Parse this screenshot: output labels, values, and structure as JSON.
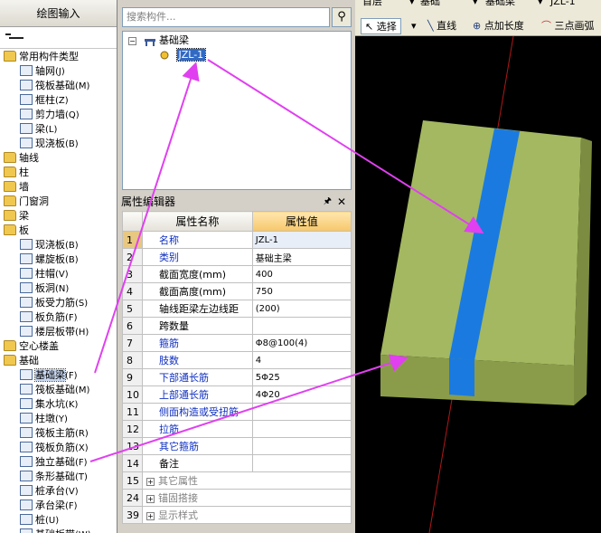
{
  "left_panel": {
    "header": "绘图输入",
    "items": [
      {
        "label": "常用构件类型",
        "type": "folder"
      },
      {
        "label": "轴网",
        "shortcut": "(J)",
        "type": "item"
      },
      {
        "label": "筏板基础",
        "shortcut": "(M)",
        "type": "item"
      },
      {
        "label": "框柱",
        "shortcut": "(Z)",
        "type": "item"
      },
      {
        "label": "剪力墙",
        "shortcut": "(Q)",
        "type": "item"
      },
      {
        "label": "梁",
        "shortcut": "(L)",
        "type": "item"
      },
      {
        "label": "现浇板",
        "shortcut": "(B)",
        "type": "item"
      },
      {
        "label": "轴线",
        "type": "folder"
      },
      {
        "label": "柱",
        "type": "folder"
      },
      {
        "label": "墙",
        "type": "folder"
      },
      {
        "label": "门窗洞",
        "type": "folder"
      },
      {
        "label": "梁",
        "type": "folder"
      },
      {
        "label": "板",
        "type": "folder"
      },
      {
        "label": "现浇板",
        "shortcut": "(B)",
        "type": "item"
      },
      {
        "label": "螺旋板",
        "shortcut": "(B)",
        "type": "item"
      },
      {
        "label": "柱帽",
        "shortcut": "(V)",
        "type": "item"
      },
      {
        "label": "板洞",
        "shortcut": "(N)",
        "type": "item"
      },
      {
        "label": "板受力筋",
        "shortcut": "(S)",
        "type": "item"
      },
      {
        "label": "板负筋",
        "shortcut": "(F)",
        "type": "item"
      },
      {
        "label": "楼层板带",
        "shortcut": "(H)",
        "type": "item"
      },
      {
        "label": "空心楼盖",
        "type": "folder"
      },
      {
        "label": "基础",
        "type": "folder"
      },
      {
        "label": "基础梁",
        "shortcut": "(F)",
        "type": "item",
        "selected": true
      },
      {
        "label": "筏板基础",
        "shortcut": "(M)",
        "type": "item"
      },
      {
        "label": "集水坑",
        "shortcut": "(K)",
        "type": "item"
      },
      {
        "label": "柱墩",
        "shortcut": "(Y)",
        "type": "item"
      },
      {
        "label": "筏板主筋",
        "shortcut": "(R)",
        "type": "item"
      },
      {
        "label": "筏板负筋",
        "shortcut": "(X)",
        "type": "item"
      },
      {
        "label": "独立基础",
        "shortcut": "(F)",
        "type": "item"
      },
      {
        "label": "条形基础",
        "shortcut": "(T)",
        "type": "item"
      },
      {
        "label": "桩承台",
        "shortcut": "(V)",
        "type": "item"
      },
      {
        "label": "承台梁",
        "shortcut": "(F)",
        "type": "item"
      },
      {
        "label": "桩",
        "shortcut": "(U)",
        "type": "item"
      },
      {
        "label": "基础板带",
        "shortcut": "(W)",
        "type": "item"
      }
    ]
  },
  "component_list": {
    "search_placeholder": "搜索构件...",
    "tree_root": "基础梁",
    "tree_child": "JZL-1"
  },
  "property_editor": {
    "title": "属性编辑器",
    "col_name": "属性名称",
    "col_value": "属性值",
    "rows": [
      {
        "num": "1",
        "name": "名称",
        "value": "JZL-1",
        "blue": true
      },
      {
        "num": "2",
        "name": "类别",
        "value": "基础主梁",
        "blue": true
      },
      {
        "num": "3",
        "name": "截面宽度(mm)",
        "value": "400",
        "blue": false
      },
      {
        "num": "4",
        "name": "截面高度(mm)",
        "value": "750",
        "blue": false
      },
      {
        "num": "5",
        "name": "轴线距梁左边线距",
        "value": "(200)",
        "blue": false
      },
      {
        "num": "6",
        "name": "跨数量",
        "value": "",
        "blue": false
      },
      {
        "num": "7",
        "name": "箍筋",
        "value": "Φ8@100(4)",
        "blue": true
      },
      {
        "num": "8",
        "name": "肢数",
        "value": "4",
        "blue": true
      },
      {
        "num": "9",
        "name": "下部通长筋",
        "value": "5Φ25",
        "blue": true
      },
      {
        "num": "10",
        "name": "上部通长筋",
        "value": "4Φ20",
        "blue": true
      },
      {
        "num": "11",
        "name": "侧面构造或受扭筋",
        "value": "",
        "blue": true
      },
      {
        "num": "12",
        "name": "拉筋",
        "value": "",
        "blue": true
      },
      {
        "num": "13",
        "name": "其它箍筋",
        "value": "",
        "blue": true
      },
      {
        "num": "14",
        "name": "备注",
        "value": "",
        "blue": false
      }
    ],
    "groups": [
      {
        "num": "15",
        "label": "其它属性"
      },
      {
        "num": "24",
        "label": "锚固搭接"
      },
      {
        "num": "39",
        "label": "显示样式"
      }
    ]
  },
  "top_bar": {
    "floor": "首层",
    "category": "基础",
    "type": "基础梁",
    "name": "JZL-1"
  },
  "draw_toolbar": {
    "select": "选择",
    "line": "直线",
    "point_length": "点加长度",
    "three_point_arc": "三点画弧"
  },
  "colors": {
    "slab_top": "#a3b860",
    "slab_front": "#8a9c4a",
    "slab_side": "#7c8c40",
    "beam": "#1a7ae0",
    "arrow": "#e040f0"
  }
}
